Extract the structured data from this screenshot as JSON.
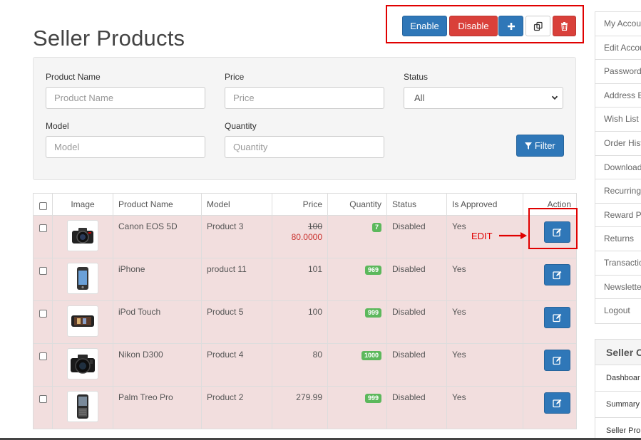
{
  "page": {
    "title": "Seller Products"
  },
  "toolbar": {
    "enable_label": "Enable",
    "disable_label": "Disable",
    "add_icon": "plus-icon",
    "copy_icon": "copy-icon",
    "delete_icon": "trash-icon"
  },
  "filter": {
    "product_name_label": "Product Name",
    "product_name_placeholder": "Product Name",
    "price_label": "Price",
    "price_placeholder": "Price",
    "status_label": "Status",
    "status_value": "All",
    "model_label": "Model",
    "model_placeholder": "Model",
    "quantity_label": "Quantity",
    "quantity_placeholder": "Quantity",
    "filter_button": "Filter"
  },
  "table": {
    "headers": {
      "image": "Image",
      "name": "Product Name",
      "model": "Model",
      "price": "Price",
      "quantity": "Quantity",
      "status": "Status",
      "approved": "Is Approved",
      "action": "Action"
    },
    "rows": [
      {
        "name": "Canon EOS 5D",
        "model": "Product 3",
        "price": "100",
        "special": "80.0000",
        "quantity": "7",
        "status": "Disabled",
        "approved": "Yes",
        "thumb": "camera"
      },
      {
        "name": "iPhone",
        "model": "product 11",
        "price": "101",
        "special": "",
        "quantity": "969",
        "status": "Disabled",
        "approved": "Yes",
        "thumb": "iphone"
      },
      {
        "name": "iPod Touch",
        "model": "Product 5",
        "price": "100",
        "special": "",
        "quantity": "999",
        "status": "Disabled",
        "approved": "Yes",
        "thumb": "ipod"
      },
      {
        "name": "Nikon D300",
        "model": "Product 4",
        "price": "80",
        "special": "",
        "quantity": "1000",
        "status": "Disabled",
        "approved": "Yes",
        "thumb": "dslr"
      },
      {
        "name": "Palm Treo Pro",
        "model": "Product 2",
        "price": "279.99",
        "special": "",
        "quantity": "999",
        "status": "Disabled",
        "approved": "Yes",
        "thumb": "palm"
      }
    ]
  },
  "annotation": {
    "edit_note": "EDIT"
  },
  "sidebar": {
    "items": [
      "My Accou",
      "Edit Accou",
      "Password",
      "Address Bo",
      "Wish List",
      "Order Hist",
      "Download",
      "Recurring",
      "Reward Po",
      "Returns",
      "Transactio",
      "Newsletter",
      "Logout"
    ]
  },
  "seller_panel": {
    "heading": "Seller C",
    "items": [
      "Dashboar",
      "Summary",
      "Seller Pro"
    ]
  },
  "colors": {
    "primary": "#2f77b8",
    "danger": "#d9403a",
    "success": "#5cb85c",
    "row_bg": "#f2dede",
    "annotation": "#e00000"
  }
}
